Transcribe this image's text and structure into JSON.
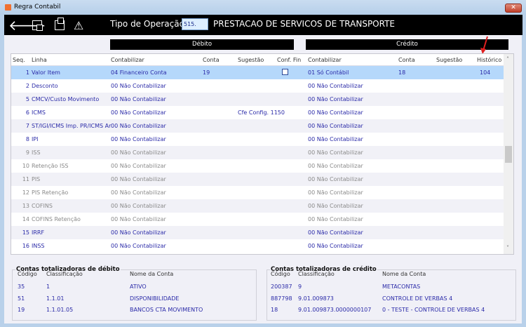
{
  "window": {
    "title": "Regra Contabil",
    "close": "✕"
  },
  "toolbar": {
    "icons": [
      "back-arrow-icon",
      "import-icon",
      "export-icon",
      "warning-icon"
    ],
    "operation_label": "Tipo de Operação",
    "operation_code": "515.",
    "operation_desc": "PRESTACAO DE SERVICOS DE TRANSPORTE"
  },
  "sections": {
    "debit": "Débito",
    "credit": "Crédito"
  },
  "grid": {
    "headers": {
      "seq": "Seq.",
      "linha": "Linha",
      "d_contabilizar": "Contabilizar",
      "d_conta": "Conta",
      "d_sugestao": "Sugestão",
      "conf_fin": "Conf. Fin",
      "c_contabilizar": "Contabilizar",
      "c_conta": "Conta",
      "c_sugestao": "Sugestão",
      "historico": "Histórico"
    },
    "rows": [
      {
        "seq": "1",
        "linha": "Valor Item",
        "d_contabilizar": "04 Financeiro Conta",
        "d_conta": "19",
        "d_sugestao": "",
        "conf_fin": false,
        "c_contabilizar": "01 Só Contábil",
        "c_conta": "18",
        "historico": "104",
        "selected": true,
        "disabled": false
      },
      {
        "seq": "2",
        "linha": "Desconto",
        "d_contabilizar": "00 Não Contabilizar",
        "d_conta": "",
        "d_sugestao": "",
        "c_contabilizar": "00 Não Contabilizar",
        "c_conta": "",
        "historico": "",
        "disabled": false
      },
      {
        "seq": "5",
        "linha": "CMCV/Custo Movimento",
        "d_contabilizar": "00 Não Contabilizar",
        "d_conta": "",
        "d_sugestao": "",
        "c_contabilizar": "00 Não Contabilizar",
        "c_conta": "",
        "historico": "",
        "disabled": false
      },
      {
        "seq": "6",
        "linha": "ICMS",
        "d_contabilizar": "00 Não Contabilizar",
        "d_conta": "",
        "d_sugestao": "Cfe Config. 1150",
        "c_contabilizar": "00 Não Contabilizar",
        "c_conta": "",
        "historico": "",
        "disabled": false
      },
      {
        "seq": "7",
        "linha": "ST/IGI/ICMS Imp. PR/ICMS Ar",
        "d_contabilizar": "00 Não Contabilizar",
        "d_conta": "",
        "d_sugestao": "",
        "c_contabilizar": "00 Não Contabilizar",
        "c_conta": "",
        "historico": "",
        "disabled": false
      },
      {
        "seq": "8",
        "linha": "IPI",
        "d_contabilizar": "00 Não Contabilizar",
        "d_conta": "",
        "d_sugestao": "",
        "c_contabilizar": "00 Não Contabilizar",
        "c_conta": "",
        "historico": "",
        "disabled": false
      },
      {
        "seq": "9",
        "linha": "ISS",
        "d_contabilizar": "00 Não Contabilizar",
        "d_conta": "",
        "d_sugestao": "",
        "c_contabilizar": "00 Não Contabilizar",
        "c_conta": "",
        "historico": "",
        "disabled": true
      },
      {
        "seq": "10",
        "linha": "Retenção ISS",
        "d_contabilizar": "00 Não Contabilizar",
        "d_conta": "",
        "d_sugestao": "",
        "c_contabilizar": "00 Não Contabilizar",
        "c_conta": "",
        "historico": "",
        "disabled": true
      },
      {
        "seq": "11",
        "linha": "PIS",
        "d_contabilizar": "00 Não Contabilizar",
        "d_conta": "",
        "d_sugestao": "",
        "c_contabilizar": "00 Não Contabilizar",
        "c_conta": "",
        "historico": "",
        "disabled": true
      },
      {
        "seq": "12",
        "linha": "PIS Retenção",
        "d_contabilizar": "00 Não Contabilizar",
        "d_conta": "",
        "d_sugestao": "",
        "c_contabilizar": "00 Não Contabilizar",
        "c_conta": "",
        "historico": "",
        "disabled": true
      },
      {
        "seq": "13",
        "linha": "COFINS",
        "d_contabilizar": "00 Não Contabilizar",
        "d_conta": "",
        "d_sugestao": "",
        "c_contabilizar": "00 Não Contabilizar",
        "c_conta": "",
        "historico": "",
        "disabled": true
      },
      {
        "seq": "14",
        "linha": "COFINS Retenção",
        "d_contabilizar": "00 Não Contabilizar",
        "d_conta": "",
        "d_sugestao": "",
        "c_contabilizar": "00 Não Contabilizar",
        "c_conta": "",
        "historico": "",
        "disabled": true
      },
      {
        "seq": "15",
        "linha": "IRRF",
        "d_contabilizar": "00 Não Contabilizar",
        "d_conta": "",
        "d_sugestao": "",
        "c_contabilizar": "00 Não Contabilizar",
        "c_conta": "",
        "historico": "",
        "disabled": false
      },
      {
        "seq": "16",
        "linha": "INSS",
        "d_contabilizar": "00 Não Contabilizar",
        "d_conta": "",
        "d_sugestao": "",
        "c_contabilizar": "00 Não Contabilizar",
        "c_conta": "",
        "historico": "",
        "disabled": false
      }
    ]
  },
  "debit_totals": {
    "title": "Contas totalizadoras de débito",
    "headers": [
      "Código",
      "Classificação",
      "Nome da Conta"
    ],
    "rows": [
      [
        "35",
        "1",
        "ATIVO"
      ],
      [
        "51",
        "1.1.01",
        "DISPONIBILIDADE"
      ],
      [
        "19",
        "1.1.01.05",
        "BANCOS CTA MOVIMENTO"
      ]
    ]
  },
  "credit_totals": {
    "title": "Contas totalizadoras de crédito",
    "headers": [
      "Código",
      "Classificação",
      "Nome da Conta"
    ],
    "rows": [
      [
        "200387",
        "9",
        "METACONTAS"
      ],
      [
        "887798",
        "9.01.009873",
        "CONTROLE DE VERBAS 4"
      ],
      [
        "18",
        "9.01.009873.0000000107",
        "0 - TESTE - CONTROLE DE VERBAS 4"
      ]
    ]
  },
  "colors": {
    "toolbar": "#000000",
    "selected_row": "#b5d8fb",
    "text_blue": "#2a2aa8",
    "text_disabled": "#8a8a8a",
    "annotation_arrow": "#e02020"
  }
}
